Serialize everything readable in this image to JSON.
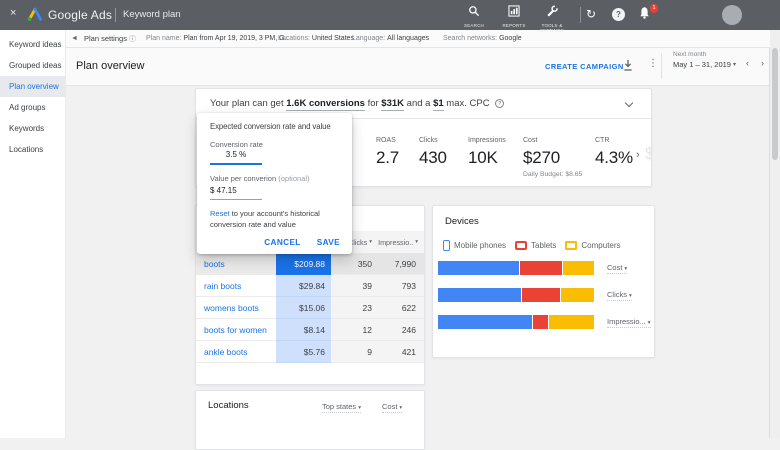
{
  "topbar": {
    "close_glyph": "×",
    "brand": "Google Ads",
    "app_title": "Keyword plan",
    "nav_tools": [
      {
        "label": "SEARCH"
      },
      {
        "label": "REPORTS"
      },
      {
        "label": "TOOLS & SETTINGS"
      }
    ],
    "refresh_glyph": "↻",
    "help_glyph": "?",
    "notification_count": "1"
  },
  "toolbar": {
    "back_glyph": "◄",
    "plan_settings_label": "Plan settings",
    "info_glyph": "ⓘ",
    "fields": [
      {
        "label": "Plan name:",
        "value": "Plan from Apr 19, 2019, 3 PM, G.."
      },
      {
        "label": "Locations:",
        "value": "United States"
      },
      {
        "label": "Language:",
        "value": "All languages"
      },
      {
        "label": "Search networks:",
        "value": "Google"
      }
    ]
  },
  "sidebar": {
    "items": [
      {
        "label": "Keyword ideas"
      },
      {
        "label": "Grouped ideas"
      },
      {
        "label": "Plan overview"
      },
      {
        "label": "Ad groups"
      },
      {
        "label": "Keywords"
      },
      {
        "label": "Locations"
      }
    ]
  },
  "header": {
    "title": "Plan overview",
    "create_campaign_label": "CREATE CAMPAIGN",
    "dots_glyph": "⋮",
    "period_label": "Next month",
    "period_value": "May 1 – 31, 2019",
    "caret_glyph": "▾",
    "prev_glyph": "‹",
    "next_glyph": "›"
  },
  "banner": {
    "prefix": "Your plan can get",
    "conversions": "1.6K conversions",
    "for_text": "for",
    "cost": "$31K",
    "and_text": "and a",
    "max_cpc": "$1",
    "suffix": "max. CPC",
    "help_glyph": "?"
  },
  "metrics": {
    "items": [
      {
        "label": "ROAS",
        "value": "2.7"
      },
      {
        "label": "Clicks",
        "value": "430"
      },
      {
        "label": "Impressions",
        "value": "10K"
      },
      {
        "label": "Cost",
        "value": "$270",
        "sub": "Daily Budget: $8.65"
      },
      {
        "label": "CTR",
        "value": "4.3%"
      }
    ],
    "scroll_glyph": "›",
    "next_partial": "$"
  },
  "dialog": {
    "title": "Expected conversion rate and value",
    "rate_label": "Conversion rate",
    "rate_value": "3.5 %",
    "value_label": "Value per converion",
    "value_optional": "(optional)",
    "value_value": "$ 47.15",
    "reset_link": "Reset",
    "reset_line1": "to your account's historical",
    "reset_line2": "conversion rate and value",
    "cancel_label": "CANCEL",
    "save_label": "SAVE"
  },
  "keywords_table": {
    "clicks_header": "Clicks",
    "impressions_header": "Impressio..",
    "caret_glyph": "▾",
    "rows": [
      {
        "keyword": "boots",
        "cost": "$209.88",
        "clicks": "350",
        "impressions": "7,990",
        "selected": true
      },
      {
        "keyword": "rain boots",
        "cost": "$29.84",
        "clicks": "39",
        "impressions": "793",
        "selected": false
      },
      {
        "keyword": "womens boots",
        "cost": "$15.06",
        "clicks": "23",
        "impressions": "622",
        "selected": false
      },
      {
        "keyword": "boots for women",
        "cost": "$8.14",
        "clicks": "12",
        "impressions": "246",
        "selected": false
      },
      {
        "keyword": "ankle boots",
        "cost": "$5.76",
        "clicks": "9",
        "impressions": "421",
        "selected": false
      }
    ]
  },
  "devices": {
    "title": "Devices",
    "legend": [
      {
        "label": "Mobile phones",
        "color": "#4285f4"
      },
      {
        "label": "Tablets",
        "color": "#ea4335"
      },
      {
        "label": "Computers",
        "color": "#fbbc04"
      }
    ],
    "bars": [
      {
        "label": "Cost",
        "mobile": 52,
        "tablet": 28,
        "computer": 20
      },
      {
        "label": "Clicks",
        "mobile": 53,
        "tablet": 26,
        "computer": 21
      },
      {
        "label": "Impressio...",
        "mobile": 60,
        "tablet": 11,
        "computer": 29
      }
    ],
    "caret_glyph": "▾"
  },
  "locations": {
    "title": "Locations",
    "filter1": "Top states",
    "filter2": "Cost",
    "caret_glyph": "▾"
  },
  "colors": {
    "accent_blue": "#1a73e8",
    "chart_blue": "#4285f4",
    "chart_red": "#ea4335",
    "chart_yellow": "#fbbc04",
    "badge_red": "#e94235",
    "topbar_gray": "#5b5e62"
  },
  "chart_data": {
    "type": "bar",
    "note": "Devices panel: horizontal 100% stacked bars (percent share per device)",
    "categories": [
      "Cost",
      "Clicks",
      "Impressions"
    ],
    "series": [
      {
        "name": "Mobile phones",
        "values": [
          52,
          53,
          60
        ]
      },
      {
        "name": "Tablets",
        "values": [
          28,
          26,
          11
        ]
      },
      {
        "name": "Computers",
        "values": [
          20,
          21,
          29
        ]
      }
    ],
    "unit": "percent",
    "legend_position": "top"
  }
}
